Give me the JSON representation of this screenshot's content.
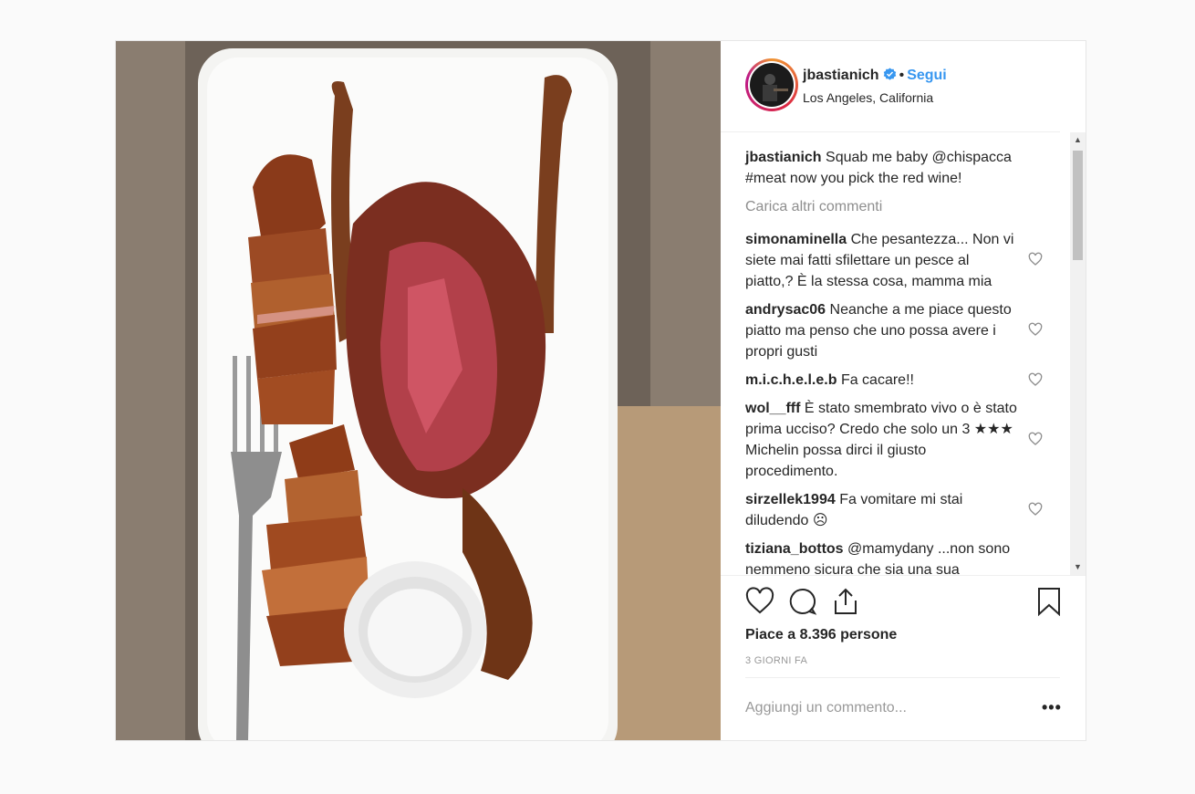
{
  "header": {
    "username": "jbastianich",
    "dot": "•",
    "follow_label": "Segui",
    "location": "Los Angeles, California"
  },
  "caption": {
    "username": "jbastianich",
    "text": "Squab me baby @chispacca #meat now you pick the red wine!"
  },
  "load_more_label": "Carica altri commenti",
  "comments": [
    {
      "user": "simonaminella",
      "text": "Che pesantezza... Non vi siete mai fatti sfilettare un pesce al piatto,? È la stessa cosa, mamma mia"
    },
    {
      "user": "andrysac06",
      "text": "Neanche a me piace questo piatto ma penso che uno possa avere i propri gusti"
    },
    {
      "user": "m.i.c.h.e.l.e.b",
      "text": "Fa cacare!!"
    },
    {
      "user": "wol__fff",
      "text": "È stato smembrato vivo o è stato prima ucciso? Credo che solo un 3 ★★★ Michelin possa dirci il giusto procedimento."
    },
    {
      "user": "sirzellek1994",
      "text": "Fa vomitare mi stai diludendo ☹"
    },
    {
      "user": "tiziana_bottos",
      "text": "@mamydany ...non sono nemmeno sicura che sia una sua"
    }
  ],
  "likes_text": "Piace a 8.396 persone",
  "time_text": "3 GIORNI FA",
  "add_comment_placeholder": "Aggiungi un commento...",
  "more_label": "•••",
  "scroll_up": "▲",
  "scroll_down": "▼",
  "icons": [
    "verified-badge-icon",
    "heart-icon",
    "comment-icon",
    "share-icon",
    "bookmark-icon",
    "small-heart-icon"
  ],
  "colors": {
    "accent": "#3897f0",
    "text": "#262626",
    "muted": "#8e8e8e"
  }
}
